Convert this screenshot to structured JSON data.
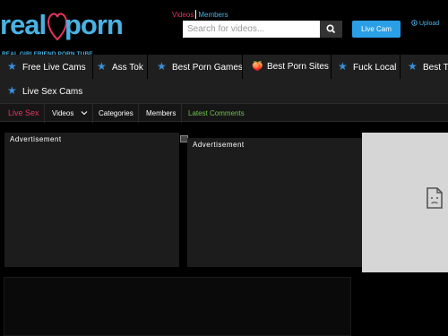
{
  "header": {
    "logo_left": "real",
    "logo_right": "porn",
    "logo_tagline": "REAL GIRLFRIEND PORN TUBE",
    "tabs": {
      "videos": "Videos",
      "members": "Members"
    },
    "search_placeholder": "Search for videos...",
    "live_cam_label": "Live Cam",
    "upload_label": "Upload"
  },
  "nav": {
    "items": [
      {
        "label": "Free Live Cams",
        "icon": "star-icon"
      },
      {
        "label": "Ass Tok",
        "icon": "star-icon"
      },
      {
        "label": "Best Porn Games",
        "icon": "star-icon"
      },
      {
        "label": "Best Porn Sites",
        "icon": "emoji-icon"
      },
      {
        "label": "Fuck Local",
        "icon": "star-icon"
      },
      {
        "label": "Best Te",
        "icon": "star-icon"
      },
      {
        "label": "Live Sex Cams",
        "icon": "star-icon"
      }
    ]
  },
  "subnav": {
    "live_sex": "Live Sex",
    "videos": "Videos",
    "categories": "Categories",
    "members": "Members",
    "latest_comments": "Latest Comments"
  },
  "ads": {
    "label_1": "Advertisement",
    "label_2": "Advertisement"
  },
  "colors": {
    "accent_blue": "#4ab2e3",
    "accent_pink": "#e8345f",
    "accent_green": "#6cc24a",
    "button_blue": "#2a9fe6"
  }
}
